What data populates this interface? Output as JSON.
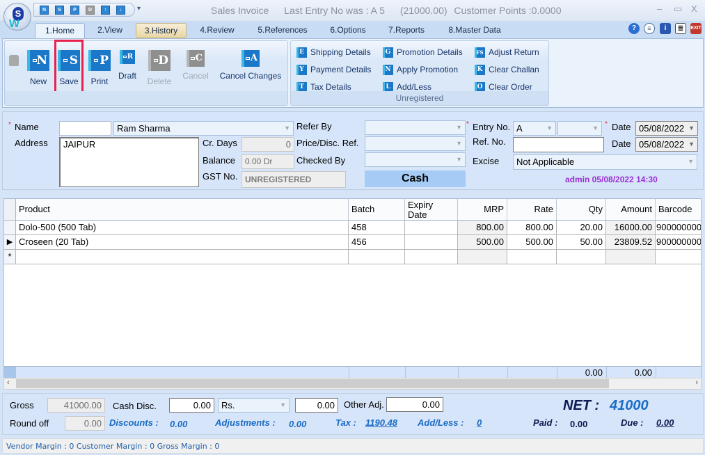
{
  "window": {
    "title": "Sales Invoice",
    "last_entry": "Last Entry No was : A 5",
    "last_amount": "(21000.00)",
    "customer_points": "Customer Points :0.0000",
    "controls": {
      "minimize": "–",
      "maximize": "▭",
      "close": "X"
    }
  },
  "quick_access": [
    {
      "icon": "new-icon",
      "glyph": "N"
    },
    {
      "icon": "save-icon",
      "glyph": "S"
    },
    {
      "icon": "print-icon",
      "glyph": "P"
    },
    {
      "icon": "delete-icon",
      "glyph": "D"
    },
    {
      "icon": "move-up-icon",
      "glyph": "↑"
    },
    {
      "icon": "move-down-icon",
      "glyph": "↓"
    }
  ],
  "tabs": [
    {
      "label": "1.Home",
      "active": true
    },
    {
      "label": "2.View"
    },
    {
      "label": "3.History",
      "highlighted": true
    },
    {
      "label": "4.Review"
    },
    {
      "label": "5.References"
    },
    {
      "label": "6.Options"
    },
    {
      "label": "7.Reports"
    },
    {
      "label": "8.Master Data"
    }
  ],
  "tab_icons": [
    "help-icon",
    "calculator-icon",
    "info-icon",
    "document-icon",
    "exit-icon"
  ],
  "ribbon": {
    "main_buttons": [
      {
        "label": "New",
        "glyph": "N",
        "enabled": true
      },
      {
        "label": "Save",
        "glyph": "S",
        "enabled": true,
        "highlighted": true
      },
      {
        "label": "Print",
        "glyph": "P",
        "enabled": true
      },
      {
        "label": "Draft",
        "glyph": "R",
        "enabled": true
      },
      {
        "label": "Delete",
        "glyph": "D",
        "enabled": false
      },
      {
        "label": "Cancel",
        "glyph": "C",
        "enabled": false
      },
      {
        "label": "Cancel Changes",
        "glyph": "A",
        "enabled": true
      }
    ],
    "detail_buttons": [
      {
        "label": "Shipping Details",
        "glyph": "E"
      },
      {
        "label": "Payment Details",
        "glyph": "Y"
      },
      {
        "label": "Tax Details",
        "glyph": "T"
      },
      {
        "label": "Promotion Details",
        "glyph": "G"
      },
      {
        "label": "Apply Promotion",
        "glyph": "N"
      },
      {
        "label": "Add/Less",
        "glyph": "L"
      },
      {
        "label": "Adjust Return",
        "glyph": "FS"
      },
      {
        "label": "Clear Challan",
        "glyph": "K"
      },
      {
        "label": "Clear Order",
        "glyph": "O"
      }
    ],
    "group_caption": "Unregistered"
  },
  "form": {
    "name_label": "Name",
    "name_code": "",
    "name_value": "Ram Sharma",
    "address_label": "Address",
    "address_value": "JAIPUR",
    "cr_days_label": "Cr. Days",
    "cr_days_value": "0",
    "balance_label": "Balance",
    "balance_value": "0.00 Dr",
    "gst_label": "GST No.",
    "gst_value": "UNREGISTERED",
    "refer_by_label": "Refer By",
    "refer_by_value": "",
    "price_ref_label": "Price/Disc. Ref.",
    "price_ref_value": "",
    "checked_by_label": "Checked By",
    "checked_by_value": "",
    "payment_mode": "Cash",
    "entry_no_label": "Entry No.",
    "entry_series": "A",
    "entry_number": "",
    "date_label": "Date",
    "date_value": "05/08/2022",
    "ref_no_label": "Ref. No.",
    "ref_no_value": "",
    "ref_date_label": "Date",
    "ref_date_value": "05/08/2022",
    "excise_label": "Excise",
    "excise_value": "Not Applicable",
    "audit": "admin 05/08/2022 14:30"
  },
  "grid": {
    "columns": [
      "Product",
      "Batch",
      "Expiry Date",
      "MRP",
      "Rate",
      "Qty",
      "Amount",
      "Barcode"
    ],
    "rows": [
      {
        "product": "Dolo-500 (500 Tab)",
        "batch": "458",
        "expiry": "",
        "mrp": "800.00",
        "rate": "800.00",
        "qty": "20.00",
        "amount": "16000.00",
        "barcode": "900000000"
      },
      {
        "product": "Croseen (20 Tab)",
        "batch": "456",
        "expiry": "",
        "mrp": "500.00",
        "rate": "500.00",
        "qty": "50.00",
        "amount": "23809.52",
        "barcode": "900000000",
        "current": true
      }
    ],
    "new_row_marker": "*",
    "totals": {
      "qty": "0.00",
      "amount": "0.00"
    }
  },
  "summary": {
    "gross_label": "Gross",
    "gross_value": "41000.00",
    "cash_disc_label": "Cash Disc.",
    "cash_disc_value": "0.00",
    "cash_disc_unit": "Rs.",
    "cash_disc_amount": "0.00",
    "other_adj_label": "Other Adj.",
    "other_adj_value": "0.00",
    "round_off_label": "Round off",
    "round_off_value": "0.00",
    "discounts_label": "Discounts :",
    "discounts_value": "0.00",
    "adjustments_label": "Adjustments :",
    "adjustments_value": "0.00",
    "tax_label": "Tax :",
    "tax_value": "1190.48",
    "addless_label": "Add/Less :",
    "addless_value": "0",
    "net_label": "NET :",
    "net_value": "41000",
    "paid_label": "Paid :",
    "paid_value": "0.00",
    "due_label": "Due :",
    "due_value": "0.00"
  },
  "status_bar": "Vendor Margin : 0 Customer Margin : 0 Gross Margin : 0"
}
